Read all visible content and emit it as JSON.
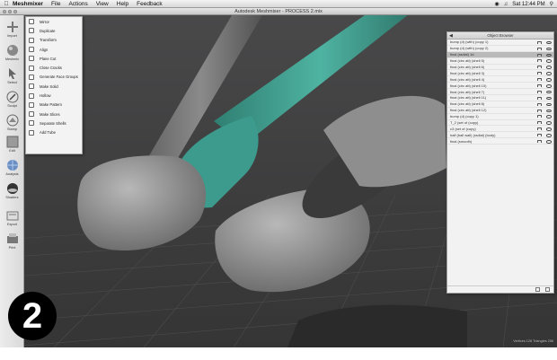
{
  "menubar": {
    "app_name": "Meshmixer",
    "items": [
      "File",
      "Actions",
      "View",
      "Help",
      "Feedback"
    ],
    "clock": "Sat 12:44 PM"
  },
  "window": {
    "title": "Autodesk Meshmixer - PROCESS 2.mix"
  },
  "toolbar": {
    "tools": [
      {
        "label": "Import",
        "icon": "plus-icon"
      },
      {
        "label": "Meshmix",
        "icon": "sphere-icon"
      },
      {
        "label": "Select",
        "icon": "cursor-icon"
      },
      {
        "label": "Sculpt",
        "icon": "brush-icon"
      },
      {
        "label": "Stamp",
        "icon": "stamp-icon"
      },
      {
        "label": "Edit",
        "icon": "edit-icon"
      },
      {
        "label": "Analysis",
        "icon": "globe-icon"
      },
      {
        "label": "Shaders",
        "icon": "shader-ball-icon"
      },
      {
        "label": "Export",
        "icon": "export-icon"
      },
      {
        "label": "Print",
        "icon": "print-icon"
      }
    ]
  },
  "edit_menu": {
    "items": [
      "Mirror",
      "Duplicate",
      "Transform",
      "Align",
      "Plane Cut",
      "Close Cracks",
      "Generate Face Groups",
      "Make Solid",
      "Hollow",
      "Make Pattern",
      "Make Slices",
      "Separate Shells",
      "Add Tube"
    ]
  },
  "object_browser": {
    "title": "Object Browser",
    "selected_index": 2,
    "objects": [
      "bump (d) (with) (copy 1)",
      "bump (d) (with) (copy 2)",
      "final (radial) 1d",
      "final (circ att) (shell 5)",
      "final (circ att) (shell 6)",
      "final (circ att) (shell 3)",
      "final (circ att) (shell 4)",
      "final (circ att) (shell 10)",
      "final (circ att) (shell 7)",
      "final (circ att) (shell 11)",
      "final (circ att) (shell 8)",
      "final (circ att) (shell 12)",
      "bump (d) (copy 1)",
      "T_2 (set of (copy)",
      "c3 (set of (copy)",
      "half (ball wall) (radial) (body)",
      "final (smooth)"
    ]
  },
  "step_number": "2",
  "status": "Vertices 128 Triangles 256",
  "colors": {
    "accent": "#3c9b8c",
    "mesh": "#9a9a9a",
    "background": "#3e3e3f"
  }
}
